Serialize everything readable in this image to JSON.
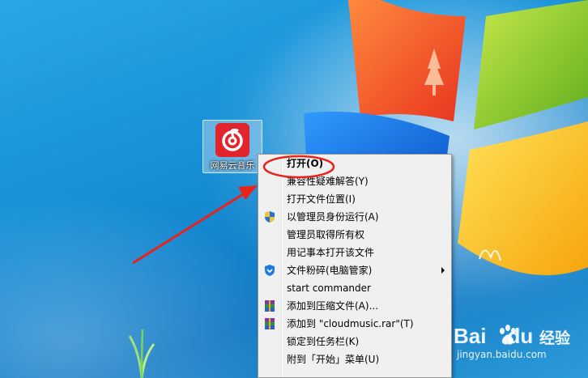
{
  "desktop": {
    "icon": {
      "label": "网易云音乐",
      "brand_color": "#e2242d"
    }
  },
  "context_menu": {
    "items": [
      {
        "label": "打开(O)",
        "bold": true,
        "icon": null
      },
      {
        "label": "兼容性疑难解答(Y)",
        "icon": null
      },
      {
        "label": "打开文件位置(I)",
        "icon": null
      },
      {
        "label": "以管理员身份运行(A)",
        "icon": "uac-shield-icon"
      },
      {
        "label": "管理员取得所有权",
        "icon": null
      },
      {
        "label": "用记事本打开该文件",
        "icon": null
      },
      {
        "label": "文件粉碎(电脑管家)",
        "icon": "tencent-shield-icon",
        "submenu": true
      },
      {
        "label": "start commander",
        "icon": null
      },
      {
        "label": "添加到压缩文件(A)...",
        "icon": "winrar-icon"
      },
      {
        "label": "添加到 \"cloudmusic.rar\"(T)",
        "icon": "winrar-icon"
      },
      {
        "label": "锁定到任务栏(K)",
        "icon": null
      },
      {
        "label": "附到「开始」菜单(U)",
        "icon": null
      }
    ]
  },
  "annotation": {
    "highlight_color": "#e8231c",
    "arrow_color": "#e8231c"
  },
  "watermark": {
    "brand": "Bai",
    "brand_end": "du",
    "jingyan": "经验",
    "url": "jingyan.baidu.com"
  }
}
